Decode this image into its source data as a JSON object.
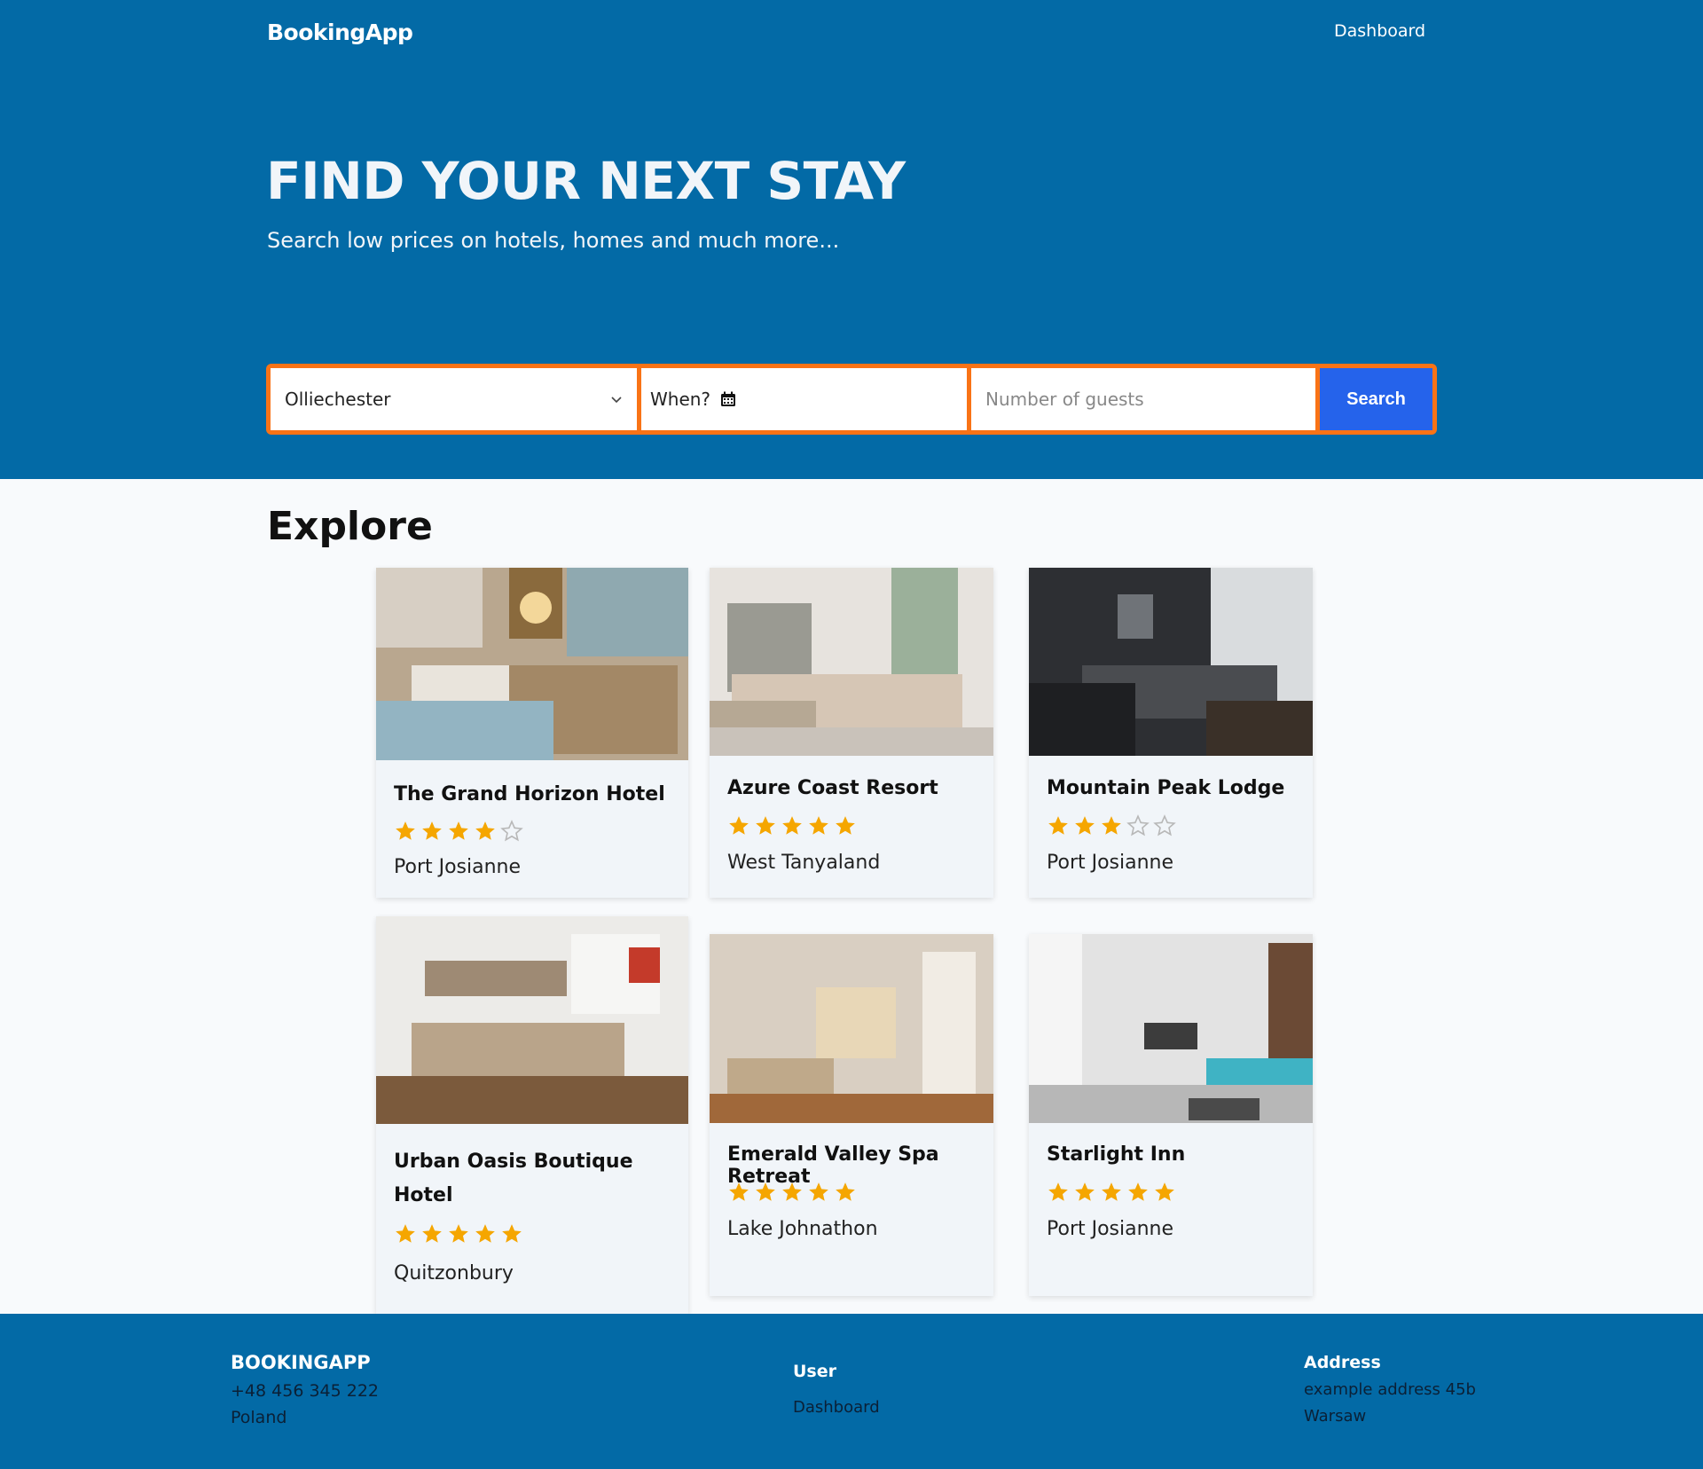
{
  "header": {
    "brand": "BookingApp",
    "nav_dashboard": "Dashboard"
  },
  "hero": {
    "title": "FIND YOUR NEXT STAY",
    "subtitle": "Search low prices on hotels, homes and much more..."
  },
  "search": {
    "destination_value": "Olliechester",
    "when_label": "When?",
    "guests_placeholder": "Number of guests",
    "button_label": "Search"
  },
  "explore": {
    "title": "Explore",
    "hotels": [
      {
        "name": "The Grand Horizon Hotel",
        "rating": 4,
        "location": "Port Josianne"
      },
      {
        "name": "Azure Coast Resort",
        "rating": 5,
        "location": "West Tanyaland"
      },
      {
        "name": "Mountain Peak Lodge",
        "rating": 3,
        "location": "Port Josianne"
      },
      {
        "name": "Urban Oasis Boutique Hotel",
        "rating": 5,
        "location": "Quitzonbury"
      },
      {
        "name": "Emerald Valley Spa Retreat",
        "rating": 5,
        "location": "Lake Johnathon"
      },
      {
        "name": "Starlight Inn",
        "rating": 5,
        "location": "Port Josianne"
      }
    ]
  },
  "footer": {
    "brand": "BOOKINGAPP",
    "phone": "+48 456 345 222",
    "country": "Poland",
    "user_heading": "User",
    "user_link": "Dashboard",
    "address_heading": "Address",
    "address_line1": "example address 45b",
    "address_line2": "Warsaw"
  },
  "colors": {
    "header_bg": "#036aa6",
    "search_border": "#f97316",
    "search_button": "#2563eb",
    "star_filled": "#f5a600",
    "star_empty": "#b8b8b8"
  }
}
